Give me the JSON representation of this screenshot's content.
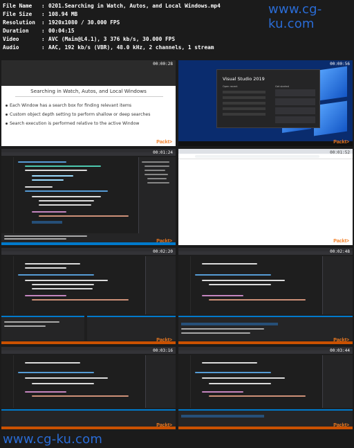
{
  "info": {
    "file_name": {
      "label": "File Name",
      "value": "0201.Searching in Watch, Autos, and Local Windows.mp4"
    },
    "file_size": {
      "label": "File Size",
      "value": "108.94 MB"
    },
    "resolution": {
      "label": "Resolution",
      "value": "1920x1080 / 30.000 FPS"
    },
    "duration": {
      "label": "Duration",
      "value": "00:04:15"
    },
    "video": {
      "label": "Video",
      "value": "AVC (Main@L4.1), 3 376 kb/s, 30.000 FPS"
    },
    "audio": {
      "label": "Audio",
      "value": "AAC, 192 kb/s (VBR), 48.0 kHz, 2 channels, 1 stream"
    },
    "separator": ":"
  },
  "watermark": "www.cg-ku.com",
  "thumbs": [
    {
      "timestamp": "00:00:28",
      "brand": "Packt>"
    },
    {
      "timestamp": "00:00:56",
      "brand": "Packt>"
    },
    {
      "timestamp": "00:01:24",
      "brand": "Packt>"
    },
    {
      "timestamp": "00:01:52",
      "brand": "Packt>"
    },
    {
      "timestamp": "00:02:20",
      "brand": "Packt>"
    },
    {
      "timestamp": "00:02:48",
      "brand": "Packt>"
    },
    {
      "timestamp": "00:03:16",
      "brand": "Packt>"
    },
    {
      "timestamp": "00:03:44",
      "brand": "Packt>"
    }
  ],
  "slide": {
    "title": "Searching in Watch, Autos, and Local Windows",
    "bullets": [
      "Each Window has a search box for finding relevant items",
      "Custom object depth setting to perform shallow or deep searches",
      "Search execution is performed relative to the active Window"
    ]
  },
  "vs_start": {
    "title": "Visual Studio 2019",
    "open_recent": "Open recent",
    "get_started": "Get started"
  },
  "colors": {
    "accent_blue": "#007acc",
    "packt_orange": "#f27c21",
    "watermark_blue": "#2a6cd6"
  }
}
